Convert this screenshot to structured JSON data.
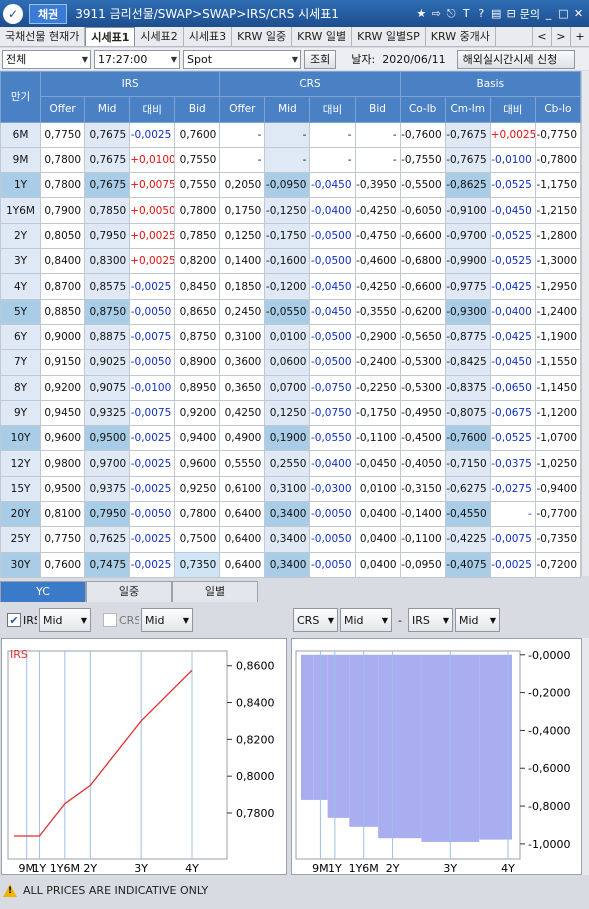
{
  "titlebar": {
    "logo_glyph": "✓",
    "badge": "채권",
    "title": "3911 금리선물/SWAP>SWAP>IRS/CRS 시세표1",
    "tools": [
      "★",
      "⇨",
      "⎋",
      "T",
      "?",
      "▤",
      "⊟",
      "문의",
      "_",
      "□",
      "✕"
    ]
  },
  "tabs": {
    "items": [
      "국채선물 현재가",
      "시세표1",
      "시세표2",
      "시세표3",
      "KRW 일중",
      "KRW 일별",
      "KRW 일별SP",
      "KRW 중개사"
    ],
    "active_index": 1,
    "nav": [
      "<",
      ">",
      "+"
    ]
  },
  "filters": {
    "market": "전체",
    "time": "17:27:00",
    "type": "Spot",
    "search_label": "조회",
    "date_label": "날자:",
    "date": "2020/06/11",
    "overseas_label": "해외실시간시세 신청"
  },
  "table": {
    "group_headers": {
      "tenor": "만기",
      "irs": "IRS",
      "crs": "CRS",
      "basis": "Basis"
    },
    "sub_headers": [
      "Offer",
      "Mid",
      "대비",
      "Bid",
      "Offer",
      "Mid",
      "대비",
      "Bid",
      "Co-lb",
      "Cm-lm",
      "대비",
      "Cb-lo"
    ],
    "rows": [
      {
        "tenor": "6M",
        "cells": [
          "0,7750",
          "0,7675",
          "-0,0025",
          "0,7600",
          "-",
          "-",
          "-",
          "-",
          "-0,7600",
          "-0,7675",
          "+0,0025",
          "-0,7750"
        ]
      },
      {
        "tenor": "9M",
        "cells": [
          "0,7800",
          "0,7675",
          "+0,0100",
          "0,7550",
          "-",
          "-",
          "-",
          "-",
          "-0,7550",
          "-0,7675",
          "-0,0100",
          "-0,7800"
        ]
      },
      {
        "tenor": "1Y",
        "cells": [
          "0,7800",
          "0,7675",
          "+0,0075",
          "0,7550",
          "0,2050",
          "-0,0950",
          "-0,0450",
          "-0,3950",
          "-0,5500",
          "-0,8625",
          "-0,0525",
          "-1,1750"
        ]
      },
      {
        "tenor": "1Y6M",
        "cells": [
          "0,7900",
          "0,7850",
          "+0,0050",
          "0,7800",
          "0,1750",
          "-0,1250",
          "-0,0400",
          "-0,4250",
          "-0,6050",
          "-0,9100",
          "-0,0450",
          "-1,2150"
        ]
      },
      {
        "tenor": "2Y",
        "cells": [
          "0,8050",
          "0,7950",
          "+0,0025",
          "0,7850",
          "0,1250",
          "-0,1750",
          "-0,0500",
          "-0,4750",
          "-0,6600",
          "-0,9700",
          "-0,0525",
          "-1,2800"
        ]
      },
      {
        "tenor": "3Y",
        "cells": [
          "0,8400",
          "0,8300",
          "+0,0025",
          "0,8200",
          "0,1400",
          "-0,1600",
          "-0,0500",
          "-0,4600",
          "-0,6800",
          "-0,9900",
          "-0,0525",
          "-1,3000"
        ]
      },
      {
        "tenor": "4Y",
        "cells": [
          "0,8700",
          "0,8575",
          "-0,0025",
          "0,8450",
          "0,1850",
          "-0,1200",
          "-0,0450",
          "-0,4250",
          "-0,6600",
          "-0,9775",
          "-0,0425",
          "-1,2950"
        ]
      },
      {
        "tenor": "5Y",
        "cells": [
          "0,8850",
          "0,8750",
          "-0,0050",
          "0,8650",
          "0,2450",
          "-0,0550",
          "-0,0450",
          "-0,3550",
          "-0,6200",
          "-0,9300",
          "-0,0400",
          "-1,2400"
        ]
      },
      {
        "tenor": "6Y",
        "cells": [
          "0,9000",
          "0,8875",
          "-0,0075",
          "0,8750",
          "0,3100",
          "0,0100",
          "-0,0500",
          "-0,2900",
          "-0,5650",
          "-0,8775",
          "-0,0425",
          "-1,1900"
        ]
      },
      {
        "tenor": "7Y",
        "cells": [
          "0,9150",
          "0,9025",
          "-0,0050",
          "0,8900",
          "0,3600",
          "0,0600",
          "-0,0500",
          "-0,2400",
          "-0,5300",
          "-0,8425",
          "-0,0450",
          "-1,1550"
        ]
      },
      {
        "tenor": "8Y",
        "cells": [
          "0,9200",
          "0,9075",
          "-0,0100",
          "0,8950",
          "0,3650",
          "0,0700",
          "-0,0750",
          "-0,2250",
          "-0,5300",
          "-0,8375",
          "-0,0650",
          "-1,1450"
        ]
      },
      {
        "tenor": "9Y",
        "cells": [
          "0,9450",
          "0,9325",
          "-0,0075",
          "0,9200",
          "0,4250",
          "0,1250",
          "-0,0750",
          "-0,1750",
          "-0,4950",
          "-0,8075",
          "-0,0675",
          "-1,1200"
        ]
      },
      {
        "tenor": "10Y",
        "cells": [
          "0,9600",
          "0,9500",
          "-0,0025",
          "0,9400",
          "0,4900",
          "0,1900",
          "-0,0550",
          "-0,1100",
          "-0,4500",
          "-0,7600",
          "-0,0525",
          "-1,0700"
        ]
      },
      {
        "tenor": "12Y",
        "cells": [
          "0,9800",
          "0,9700",
          "-0,0025",
          "0,9600",
          "0,5550",
          "0,2550",
          "-0,0400",
          "-0,0450",
          "-0,4050",
          "-0,7150",
          "-0,0375",
          "-1,0250"
        ]
      },
      {
        "tenor": "15Y",
        "cells": [
          "0,9500",
          "0,9375",
          "-0,0025",
          "0,9250",
          "0,6100",
          "0,3100",
          "-0,0300",
          "0,0100",
          "-0,3150",
          "-0,6275",
          "-0,0275",
          "-0,9400"
        ]
      },
      {
        "tenor": "20Y",
        "cells": [
          "0,8100",
          "0,7950",
          "-0,0050",
          "0,7800",
          "0,6400",
          "0,3400",
          "-0,0050",
          "0,0400",
          "-0,1400",
          "-0,4550",
          "-",
          "-0,7700"
        ]
      },
      {
        "tenor": "25Y",
        "cells": [
          "0,7750",
          "0,7625",
          "-0,0025",
          "0,7500",
          "0,6400",
          "0,3400",
          "-0,0050",
          "0,0400",
          "-0,1100",
          "-0,4225",
          "-0,0075",
          "-0,7350"
        ]
      },
      {
        "tenor": "30Y",
        "cells": [
          "0,7600",
          "0,7475",
          "-0,0025",
          "0,7350",
          "0,6400",
          "0,3400",
          "-0,0050",
          "0,0400",
          "-0,0950",
          "-0,4075",
          "-0,0025",
          "-0,7200"
        ]
      }
    ],
    "highlight_tenors": [
      "1Y",
      "5Y",
      "10Y",
      "20Y",
      "30Y"
    ]
  },
  "chart_tabs": {
    "items": [
      "YC",
      "일중",
      "일별"
    ],
    "active_index": 0
  },
  "chart_controls": {
    "irs_label": "IRS",
    "irs_checked": true,
    "irs_mode": "Mid",
    "crs_label": "CRS",
    "crs_checked": false,
    "crs_mode": "Mid",
    "spread_a": "CRS",
    "spread_a_mode": "Mid",
    "minus": "-",
    "spread_b": "IRS",
    "spread_b_mode": "Mid"
  },
  "chart_data": [
    {
      "type": "line",
      "legend": "IRS",
      "x": [
        "6M",
        "9M",
        "1Y",
        "1Y6M",
        "2Y",
        "3Y",
        "4Y"
      ],
      "x_years": [
        0.5,
        0.75,
        1,
        1.5,
        2,
        3,
        4
      ],
      "values": [
        0.7675,
        0.7675,
        0.7675,
        0.785,
        0.795,
        0.83,
        0.8575
      ],
      "ylim": [
        0.755,
        0.868
      ],
      "yticks": [
        "0,8600",
        "0,8400",
        "0,8200",
        "0,8000",
        "0,7800"
      ],
      "ytick_values": [
        0.86,
        0.84,
        0.82,
        0.8,
        0.78
      ],
      "xticks": [
        "9M",
        "1Y",
        "1Y6M",
        "2Y",
        "3Y",
        "4Y"
      ],
      "xtick_years": [
        0.75,
        1,
        1.5,
        2,
        3,
        4
      ],
      "line_color": "#e23030"
    },
    {
      "type": "bar",
      "categories": [
        "6M",
        "9M",
        "1Y",
        "1Y6M",
        "2Y",
        "3Y",
        "4Y"
      ],
      "x_years": [
        0.5,
        0.75,
        1,
        1.5,
        2,
        3,
        4
      ],
      "values": [
        -0.7675,
        -0.7675,
        -0.8625,
        -0.91,
        -0.97,
        -0.99,
        -0.9775
      ],
      "ylim": [
        -1.08,
        0.02
      ],
      "yticks": [
        "-0,0000",
        "-0,2000",
        "-0,4000",
        "-0,6000",
        "-0,8000",
        "-1,0000"
      ],
      "ytick_values": [
        0,
        -0.2,
        -0.4,
        -0.6,
        -0.8,
        -1.0
      ],
      "xticks": [
        "9M",
        "1Y",
        "1Y6M",
        "2Y",
        "3Y",
        "4Y"
      ],
      "xtick_years": [
        0.75,
        1,
        1.5,
        2,
        3,
        4
      ],
      "bar_color": "#a9aef0"
    }
  ],
  "footer": {
    "text": "ALL PRICES ARE INDICATIVE ONLY",
    "icon_glyph": "!"
  }
}
